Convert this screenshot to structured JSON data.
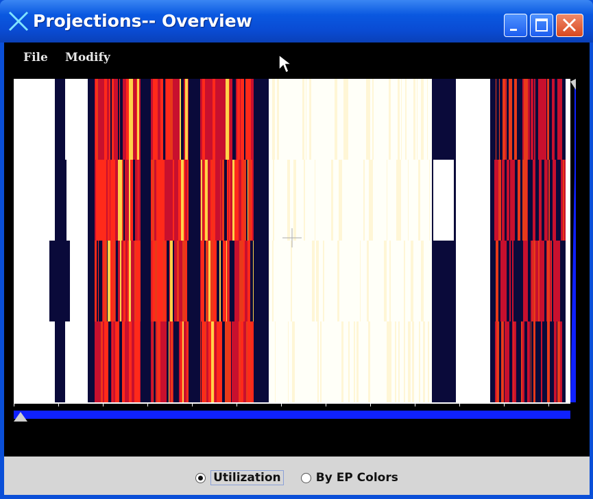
{
  "window": {
    "title": "Projections-- Overview",
    "accent": "#0a4fd8",
    "controls": [
      "minimize-icon",
      "maximize-icon",
      "close-icon"
    ]
  },
  "menu": {
    "items": [
      {
        "label": "File"
      },
      {
        "label": "Modify"
      }
    ]
  },
  "overview": {
    "rows": 4,
    "colors": {
      "idle": "#0a0a3a",
      "low": "#c8102e",
      "mid": "#e83a1a",
      "high": "#ff2a1a",
      "peak": "#ffd24a",
      "none": "#fffff8",
      "separator": "#ffffff",
      "scrollbar": "#0f21ff"
    }
  },
  "view_mode": {
    "options": [
      {
        "label": "Utilization",
        "selected": true
      },
      {
        "label": "By EP Colors",
        "selected": false
      }
    ]
  }
}
